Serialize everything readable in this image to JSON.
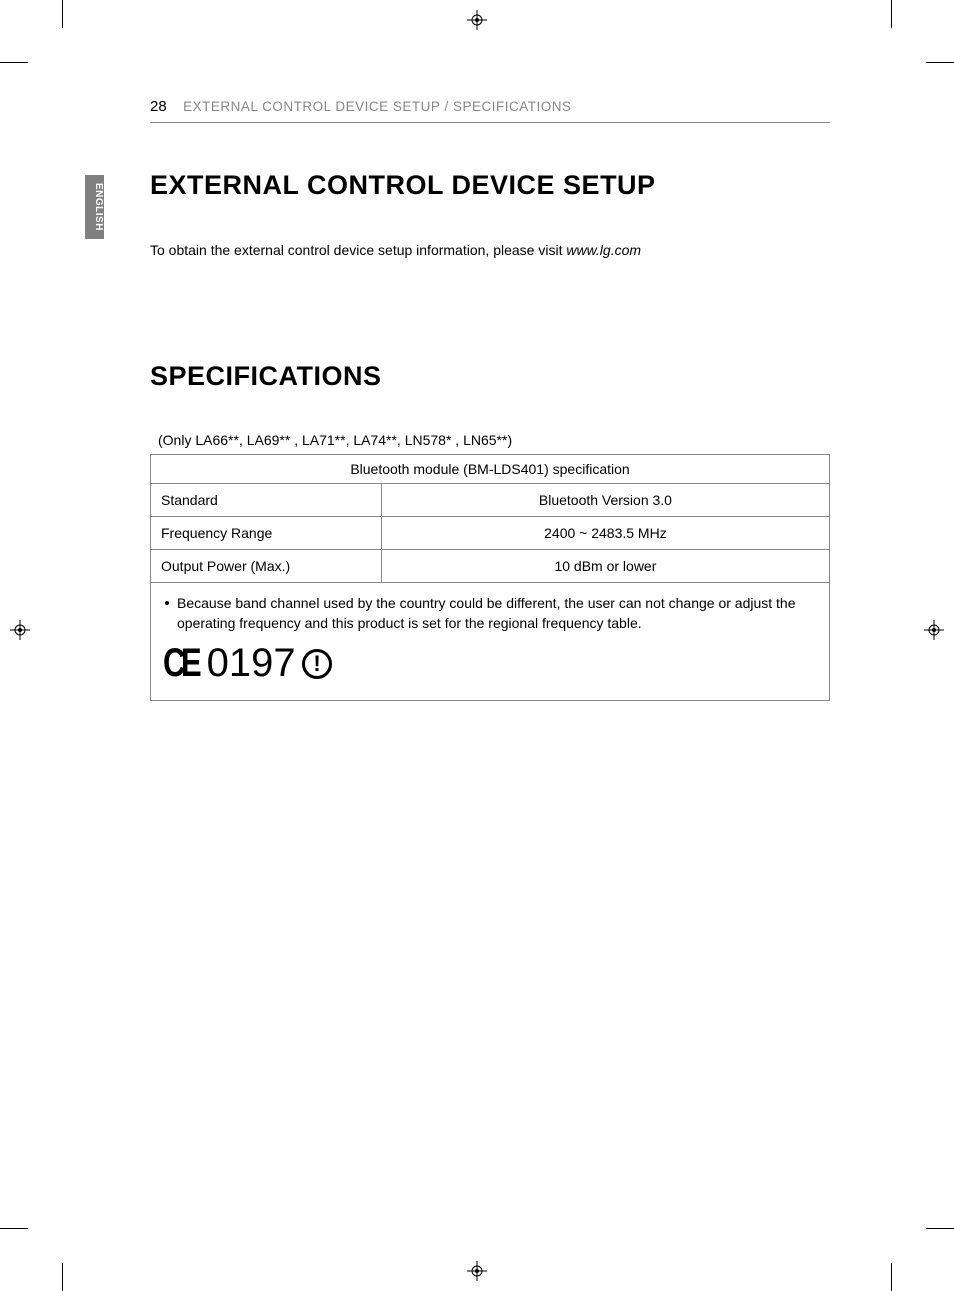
{
  "page_number": "28",
  "header_title": "EXTERNAL CONTROL DEVICE SETUP / SPECIFICATIONS",
  "language_tab": "ENGLISH",
  "section1": {
    "heading": "EXTERNAL CONTROL DEVICE SETUP",
    "body_prefix": "To obtain the external control device setup information, please visit ",
    "body_link": "www.lg.com"
  },
  "section2": {
    "heading": "SPECIFICATIONS",
    "models_note": "(Only LA66**, LA69** , LA71**, LA74**, LN578* , LN65**)",
    "table_title": "Bluetooth module (BM-LDS401) specification",
    "rows": [
      {
        "label": "Standard",
        "value": "Bluetooth Version 3.0"
      },
      {
        "label": "Frequency Range",
        "value": "2400 ~ 2483.5 MHz"
      },
      {
        "label": "Output Power (Max.)",
        "value": "10 dBm or lower"
      }
    ],
    "note": "Because band channel used by the country could be different, the user can not change or adjust the operating frequency and this product is set for the regional frequency table.",
    "ce_number": "0197"
  }
}
